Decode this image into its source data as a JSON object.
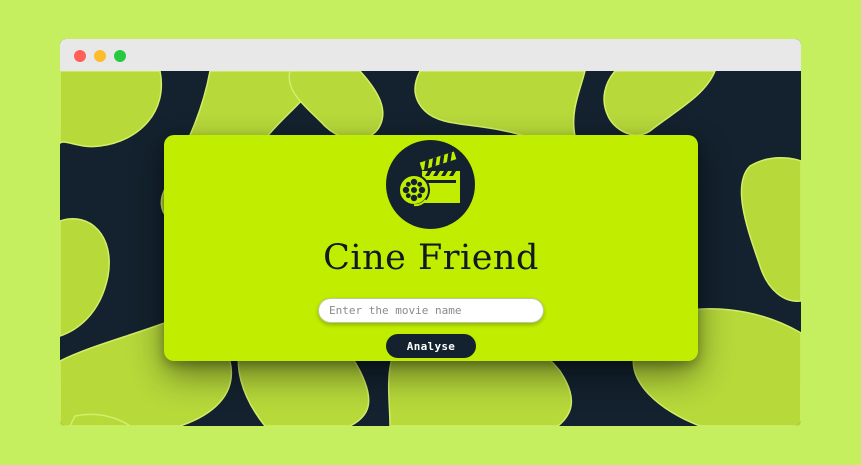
{
  "app": {
    "title": "Cine Friend"
  },
  "search": {
    "placeholder": "Enter the movie name",
    "value": ""
  },
  "actions": {
    "analyse_label": "Analyse"
  },
  "colors": {
    "page_background": "#c5ef5e",
    "card_background": "#c1ee00",
    "dark_navy": "#13222e",
    "blob_green": "#b7d93a"
  },
  "icons": {
    "logo": "movie-clapperboard-reel-icon"
  }
}
